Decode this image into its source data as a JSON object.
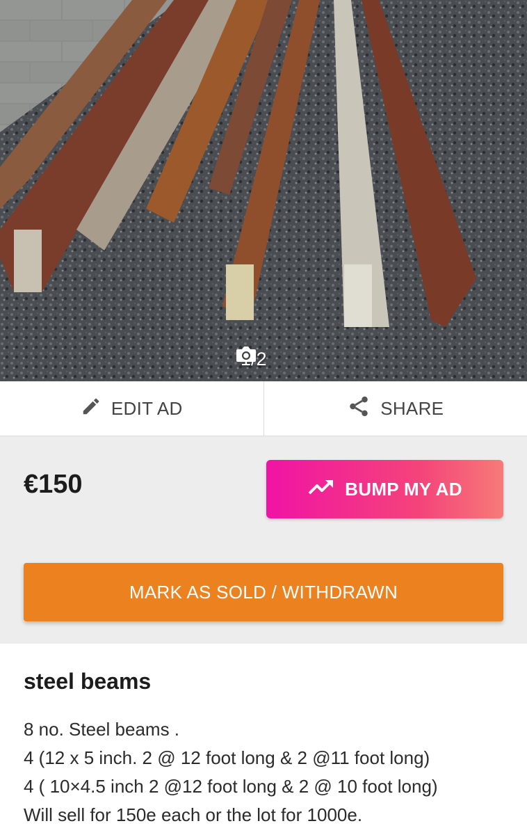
{
  "photo": {
    "counter": "1/2",
    "icon": "camera-icon"
  },
  "actions": {
    "edit_label": "EDIT AD",
    "edit_icon": "pencil-icon",
    "share_label": "SHARE",
    "share_icon": "share-icon"
  },
  "listing": {
    "price": "€150",
    "bump_label": "BUMP MY AD",
    "bump_icon": "trending-up-icon",
    "sold_label": "MARK AS SOLD / WITHDRAWN",
    "title": "steel beams",
    "description": [
      "8 no. Steel beams .",
      "4 (12 x 5 inch. 2 @ 12 foot long & 2 @11 foot long)",
      "4 ( 10×4.5 inch 2 @12 foot long & 2 @ 10 foot long)",
      "Will sell for 150e each or the lot for 1000e."
    ]
  },
  "colors": {
    "bump_gradient_start": "#f013a4",
    "bump_gradient_end": "#f77a78",
    "sold_button": "#ec8120",
    "panel_background": "#ededed"
  }
}
